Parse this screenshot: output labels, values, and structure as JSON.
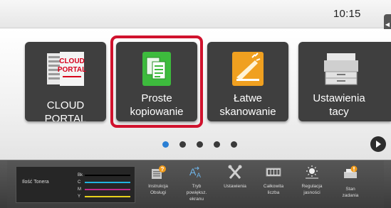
{
  "status": {
    "clock": "10:15"
  },
  "tiles": [
    {
      "label": "CLOUD PORTAL",
      "logo_line1": "CLOUD",
      "logo_line2": "PORTAL",
      "icon": "cloud-portal-icon"
    },
    {
      "label": "Proste kopiowanie",
      "line1": "Proste",
      "line2": "kopiowanie",
      "icon": "copy-icon",
      "highlighted": true
    },
    {
      "label": "Łatwe skanowanie",
      "line1": "Łatwe",
      "line2": "skanowanie",
      "icon": "scanner-icon"
    },
    {
      "label": "Ustawienia tacy",
      "line1": "Ustawienia",
      "line2": "tacy",
      "icon": "printer-tray-icon"
    }
  ],
  "pager": {
    "pages": 5,
    "current": 1
  },
  "toner": {
    "label": "Ilość Tonera",
    "colors": [
      {
        "name": "Bk",
        "level": 1.0,
        "color": "#000000"
      },
      {
        "name": "C",
        "level": 1.0,
        "color": "#1fb3e0"
      },
      {
        "name": "M",
        "level": 1.0,
        "color": "#c22a8a"
      },
      {
        "name": "Y",
        "level": 1.0,
        "color": "#e8d21c"
      }
    ]
  },
  "functions": [
    {
      "line1": "Instrukcja",
      "line2": "Obsługi",
      "line3": "",
      "icon": "manual-icon"
    },
    {
      "line1": "Tryb",
      "line2": "powiększ.",
      "line3": "ekranu",
      "icon": "text-enlarge-icon"
    },
    {
      "line1": "Ustawienia",
      "line2": "",
      "line3": "",
      "icon": "tools-icon"
    },
    {
      "line1": "Całkowita",
      "line2": "liczba",
      "line3": "",
      "icon": "counter-icon"
    },
    {
      "line1": "Regulacja",
      "line2": "jasności",
      "line3": "",
      "icon": "brightness-icon"
    },
    {
      "line1": "Stan",
      "line2": "zadania",
      "line3": "",
      "icon": "job-status-icon"
    }
  ],
  "colors": {
    "accent_highlight": "#d0122d",
    "tile_bg": "#3f3f3f",
    "active_dot": "#2a7fd4"
  }
}
